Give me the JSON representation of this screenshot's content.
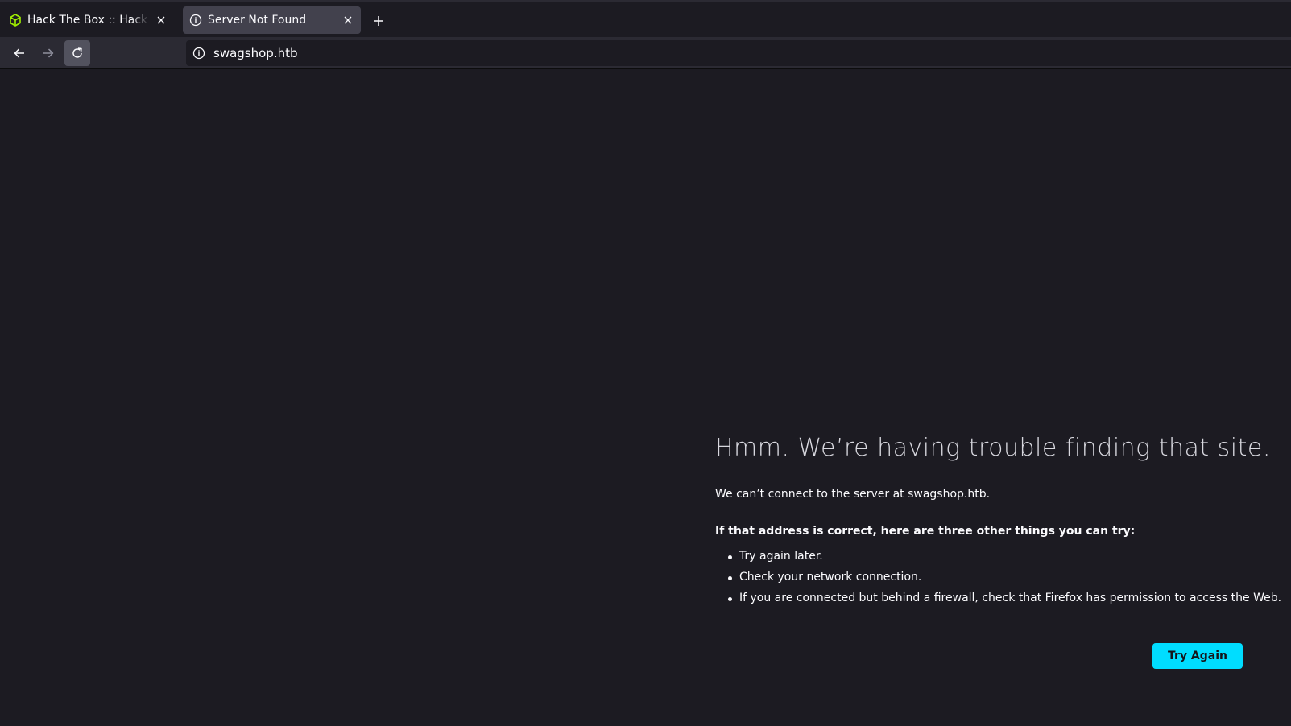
{
  "browser": {
    "tabs": [
      {
        "title": "Hack The Box :: Hack The Box",
        "icon": "htb-cube-icon",
        "active": false
      },
      {
        "title": "Server Not Found",
        "icon": "info-icon",
        "active": true
      }
    ],
    "url": "swagshop.htb"
  },
  "error": {
    "title": "Hmm. We’re having trouble finding that site.",
    "description": "We can’t connect to the server at swagshop.htb.",
    "subheading": "If that address is correct, here are three other things you can try:",
    "suggestions": [
      "Try again later.",
      "Check your network connection.",
      "If you are connected but behind a firewall, check that Firefox has permission to access the Web."
    ],
    "button_label": "Try Again"
  },
  "colors": {
    "background": "#1c1b22",
    "toolbar": "#2b2a33",
    "accent_button": "#00ddff",
    "htb_green": "#9fef00"
  }
}
